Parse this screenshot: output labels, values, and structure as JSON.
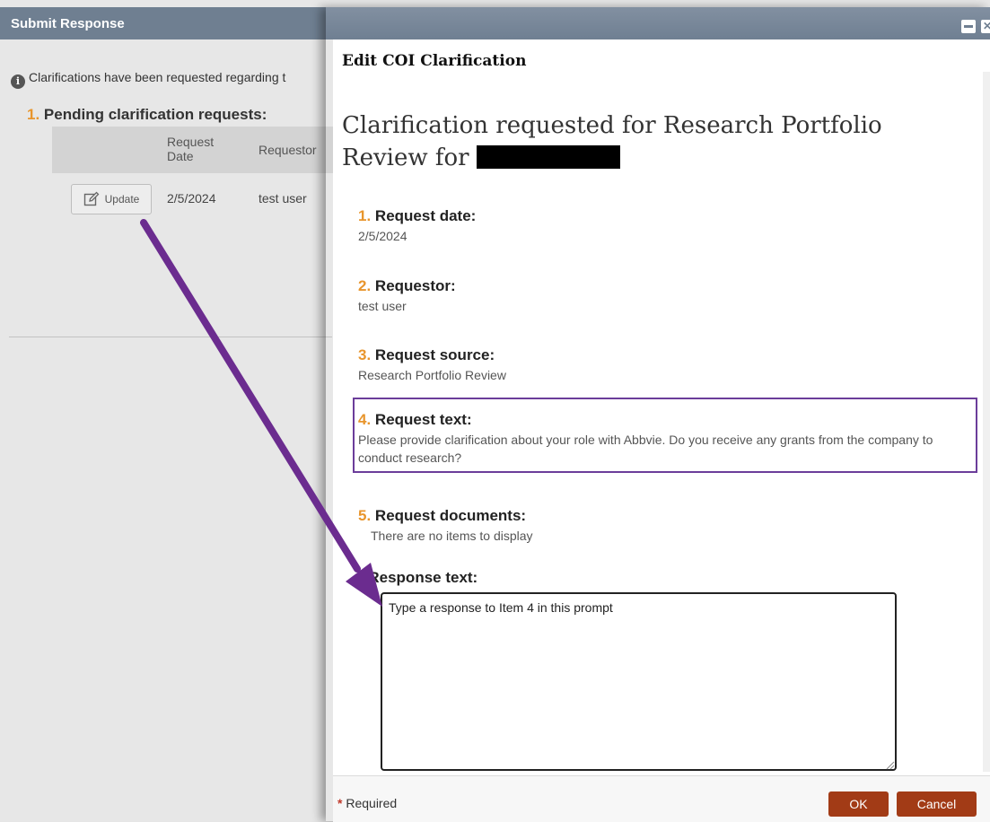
{
  "background_window": {
    "title": "Submit Response",
    "info_text": "Clarifications have been requested regarding t",
    "section_number": "1.",
    "section_title": "Pending clarification requests:",
    "table": {
      "headers": [
        "Request Date",
        "Requestor"
      ],
      "rows": [
        {
          "action_label": "Update",
          "date": "2/5/2024",
          "requestor": "test user"
        }
      ]
    }
  },
  "dialog": {
    "header": "Edit COI Clarification",
    "heading": "Clarification requested for  Research Portfolio Review for",
    "fields": [
      {
        "number": "1.",
        "label": "Request date:",
        "value": "2/5/2024"
      },
      {
        "number": "2.",
        "label": "Requestor:",
        "value": "test user"
      },
      {
        "number": "3.",
        "label": "Request source:",
        "value": "Research Portfolio Review"
      },
      {
        "number": "4.",
        "label": "Request text:",
        "value": "Please provide clarification about your role with Abbvie. Do you receive any grants from the company to conduct research?"
      },
      {
        "number": "5.",
        "label": "Request documents:",
        "value": "There are no items to display"
      }
    ],
    "response": {
      "required_marker": "*",
      "label": "Response text:",
      "value": "Type a response to Item 4 in this prompt"
    },
    "footer": {
      "required_marker": "*",
      "required_note": "Required",
      "ok_label": "OK",
      "cancel_label": "Cancel"
    }
  },
  "colors": {
    "titlebar": "#6f7f91",
    "accent_number": "#e8952c",
    "highlight_border": "#6b3d9a",
    "annotation_arrow": "#6b2c8f",
    "primary_button": "#a23b16"
  }
}
